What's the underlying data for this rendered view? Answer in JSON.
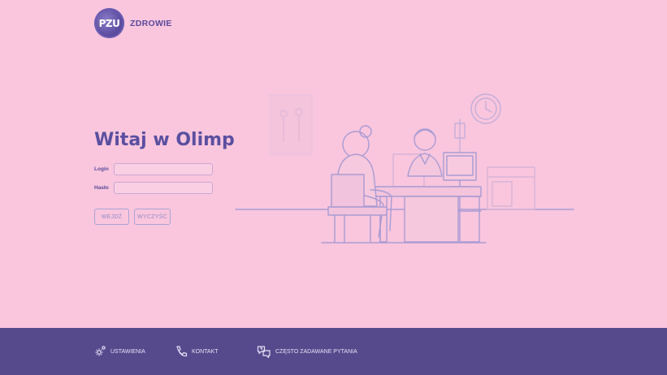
{
  "brand": {
    "logo_text": "PZU",
    "name": "ZDROWIE"
  },
  "main": {
    "title": "Witaj w Olimp",
    "login": {
      "label": "Login",
      "value": "",
      "placeholder": ""
    },
    "password": {
      "label": "Hasło",
      "value": "",
      "placeholder": ""
    },
    "buttons": {
      "enter": "WEJDŹ",
      "clear": "WYCZYŚĆ"
    }
  },
  "footer": {
    "settings": {
      "label": "USTAWIENIA",
      "icon": "gear-icon"
    },
    "contact": {
      "label": "KONTAKT",
      "icon": "phone-icon"
    },
    "faq": {
      "label": "CZĘSTO ZADAWANE PYTANIA",
      "icon": "chat-question-icon"
    }
  },
  "colors": {
    "background": "#f9c6de",
    "accent": "#5a4fa0",
    "footer": "#564a8d"
  }
}
